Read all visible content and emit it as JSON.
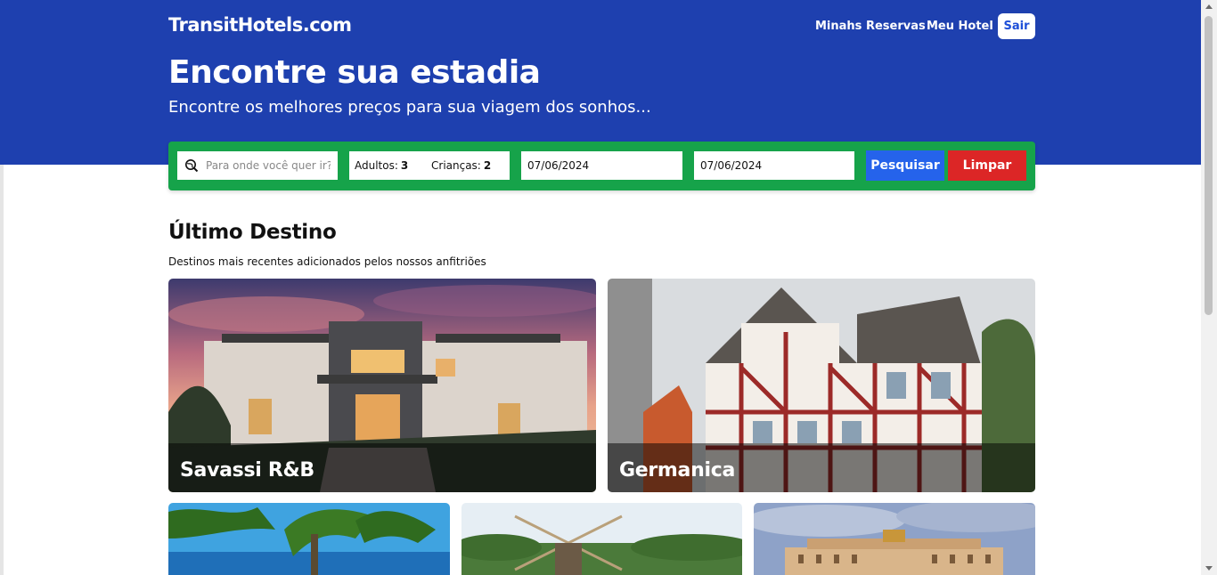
{
  "header": {
    "logo": "TransitHotels.com",
    "nav": {
      "reservations": "Minahs Reservas",
      "my_hotel": "Meu Hotel",
      "logout": "Sair"
    }
  },
  "hero": {
    "title": "Encontre sua estadia",
    "subtitle": "Encontre os melhores preços para sua viagem dos sonhos..."
  },
  "search": {
    "destination_placeholder": "Para onde você quer ir?",
    "adults_label": "Adultos:",
    "adults_value": "3",
    "children_label": "Crianças:",
    "children_value": "2",
    "check_in": "07/06/2024",
    "check_out": "07/06/2024",
    "search_button": "Pesquisar",
    "clear_button": "Limpar"
  },
  "destinations": {
    "title": "Último Destino",
    "subtitle": "Destinos mais recentes adicionados pelos nossos anfitriões",
    "cards": [
      {
        "name": "Savassi R&B"
      },
      {
        "name": "Germanica"
      },
      {
        "name": ""
      },
      {
        "name": ""
      },
      {
        "name": ""
      }
    ]
  },
  "colors": {
    "hero_blue": "#1e40af",
    "search_green": "#16a34a",
    "search_button": "#2563eb",
    "clear_button": "#dc2626"
  }
}
